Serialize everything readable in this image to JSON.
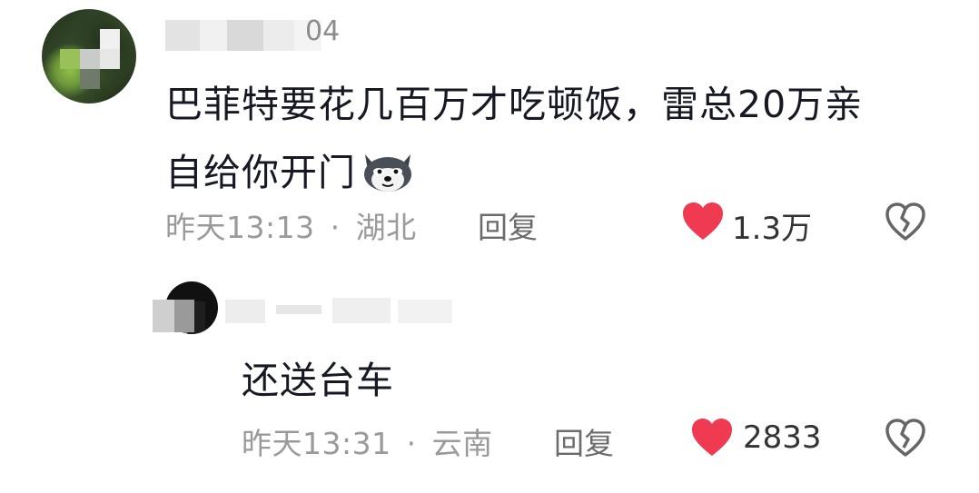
{
  "comment": {
    "username_visible_tail": "04",
    "text_line1": "巴菲特要花几百万才吃顿饭，雷总20万亲",
    "text_line2": "自给你开门",
    "time": "昨天13:13",
    "separator": "·",
    "location": "湖北",
    "reply_label": "回复",
    "likes": "1.3万",
    "icons": {
      "emoji": "husky-dog-emoji",
      "like": "heart-icon",
      "dislike": "broken-heart-icon"
    }
  },
  "reply": {
    "text": "还送台车",
    "time": "昨天13:31",
    "separator": "·",
    "location": "云南",
    "reply_label": "回复",
    "likes": "2833",
    "icons": {
      "like": "heart-icon",
      "dislike": "broken-heart-icon"
    }
  },
  "colors": {
    "heart": "#f03a52",
    "meta_text": "#9a9a9a",
    "main_text": "#161823"
  }
}
